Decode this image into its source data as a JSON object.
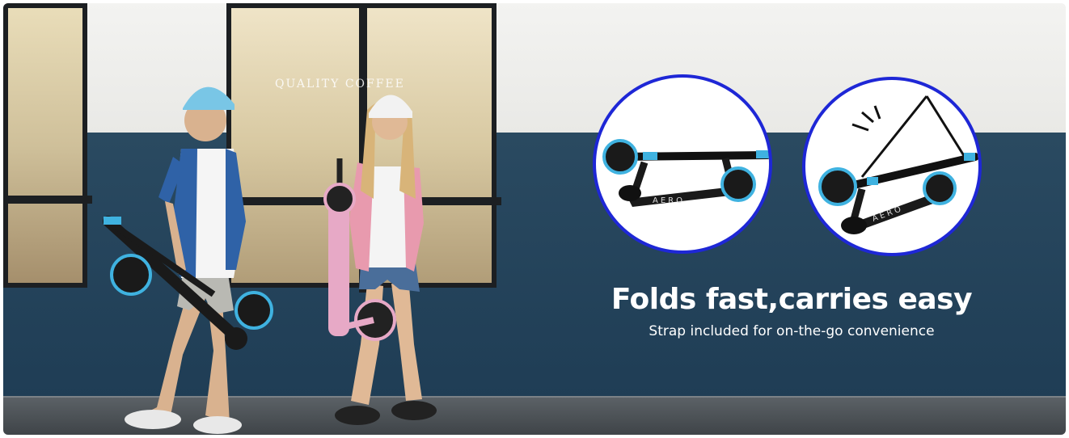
{
  "banner": {
    "headline": "Folds fast,carries easy",
    "subheadline": "Strap included for on-the-go convenience",
    "scene_text": {
      "cafe_sign": "QUALITY COFFEE",
      "brand_on_scooter": "AERO"
    }
  },
  "colors": {
    "wall_blue": "#1f3d55",
    "wall_white": "#eeeeec",
    "circle_border": "#1e27d6",
    "scooter_accent": "#3fb2e0",
    "helmet_boy": "#79c6e6",
    "helmet_girl": "#f2f2f2",
    "scooter_pink": "#e7a9c6"
  },
  "icons": {
    "folded_scooter_1": "folded-scooter-icon",
    "folded_scooter_2": "folded-scooter-with-strap-icon"
  }
}
